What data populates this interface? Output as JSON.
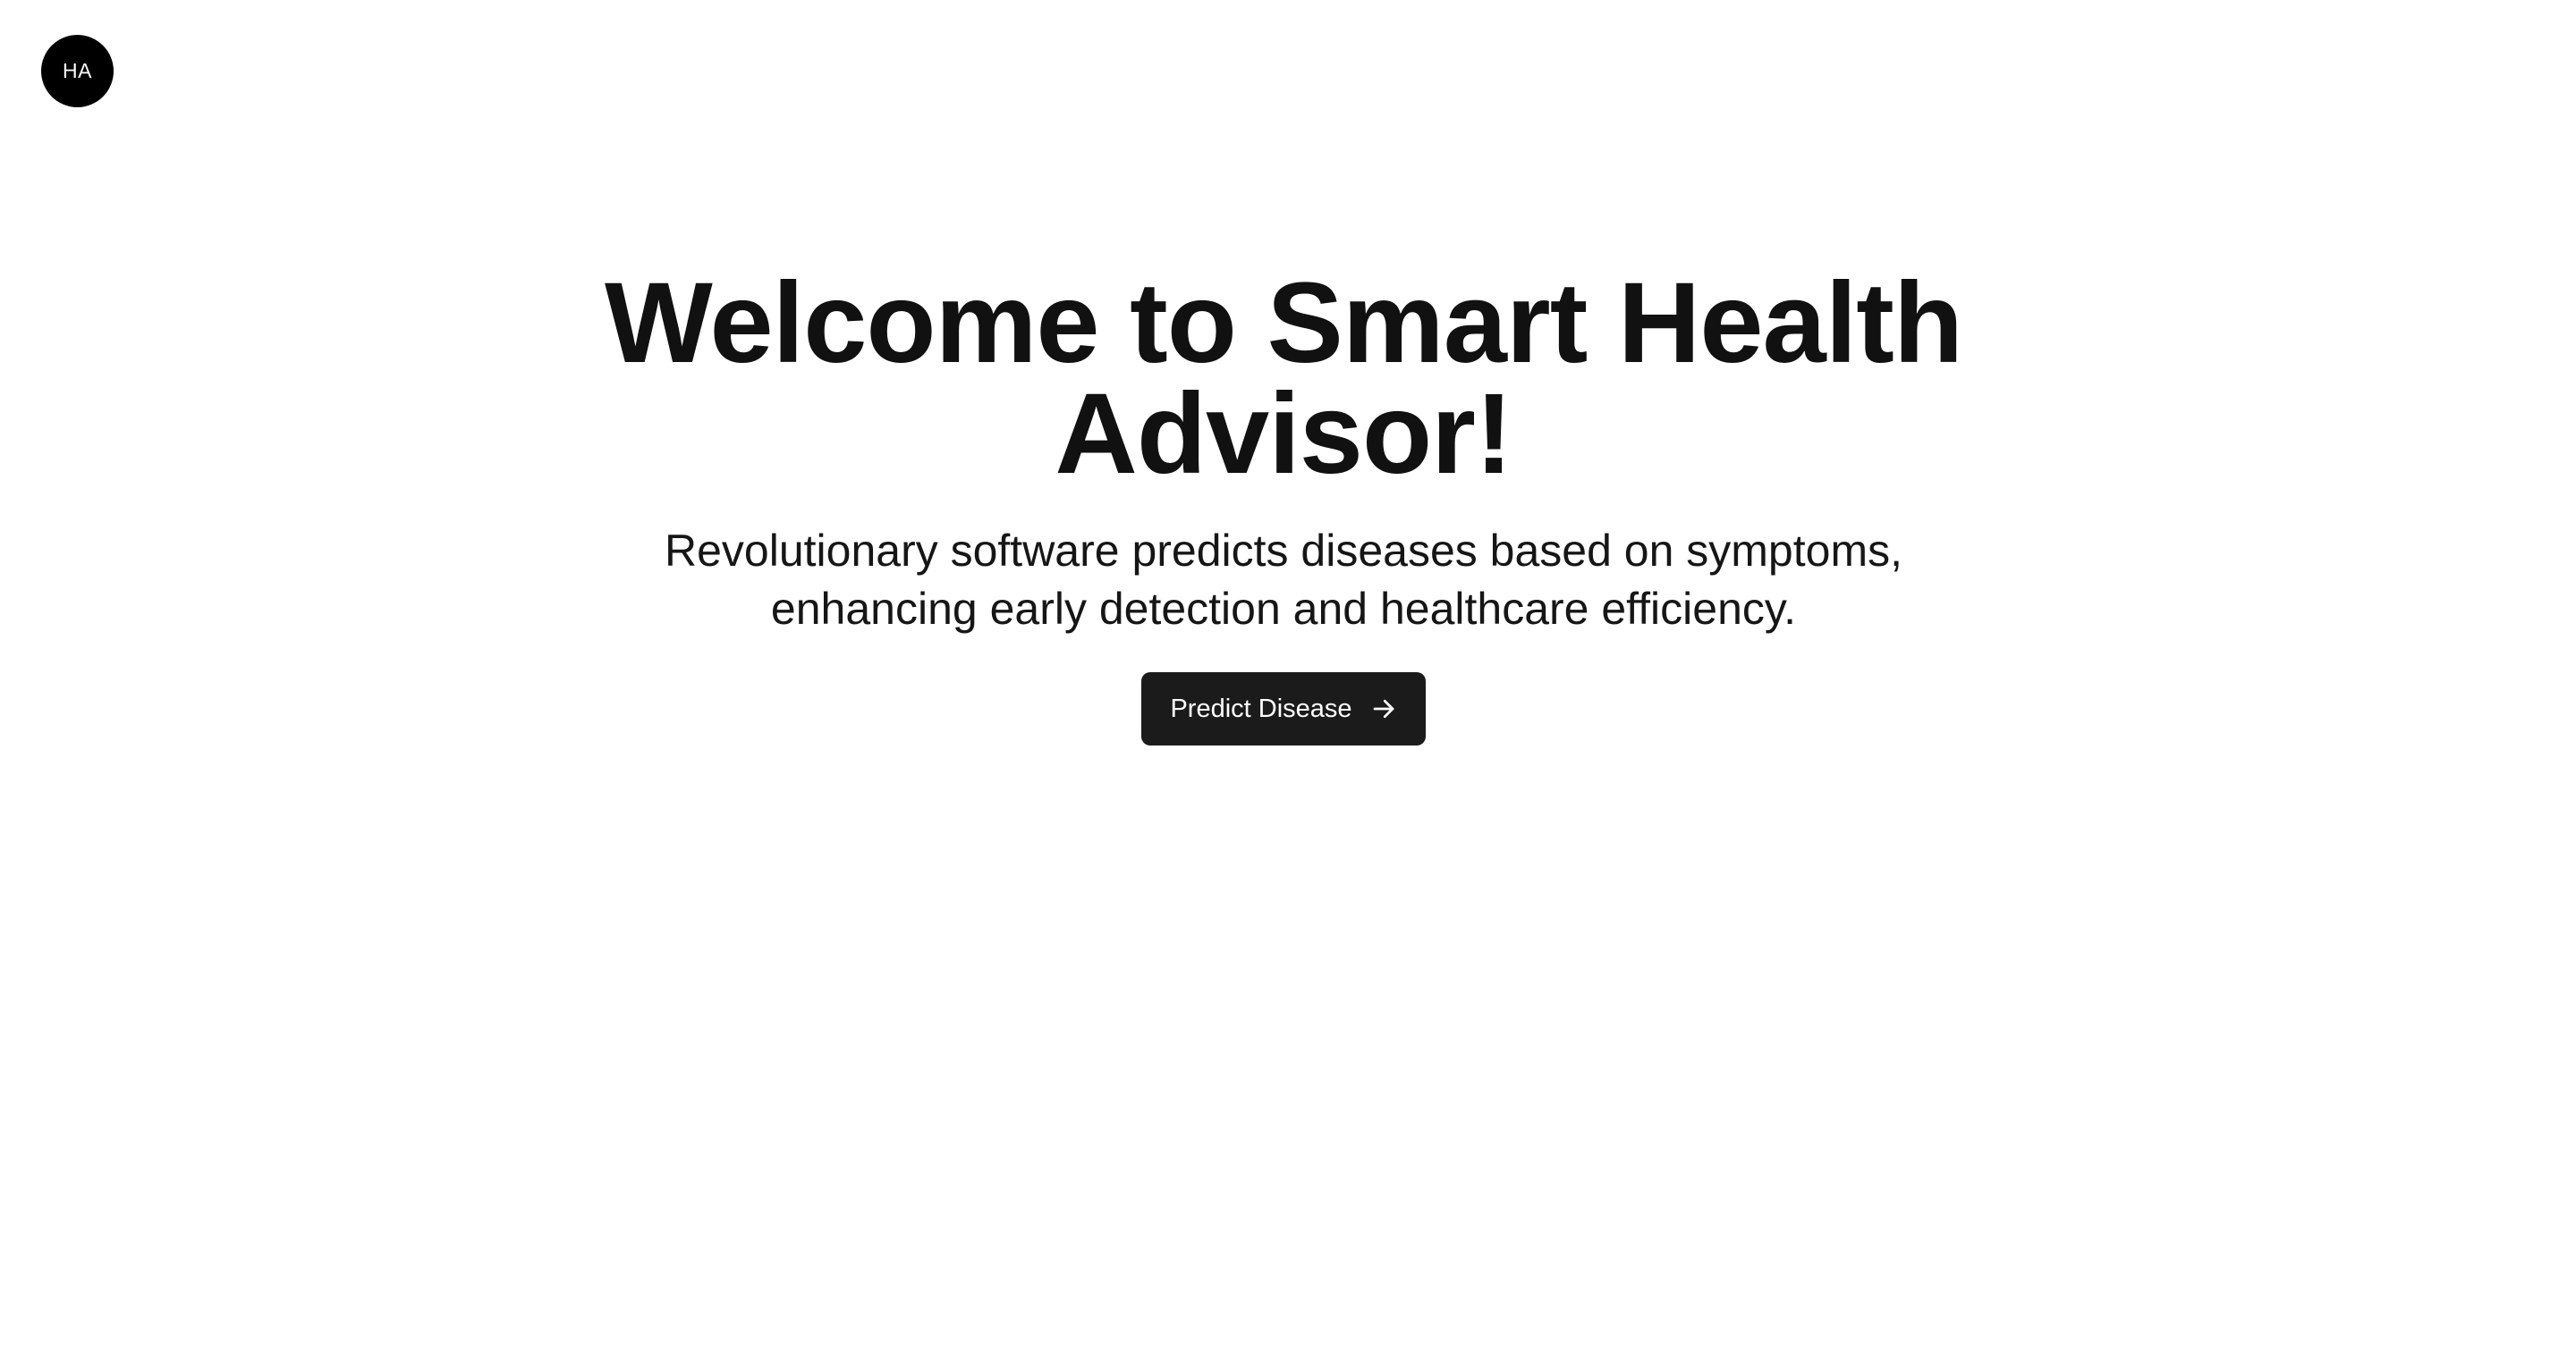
{
  "header": {
    "avatar_initials": "HA"
  },
  "hero": {
    "title": "Welcome to Smart Health Advisor!",
    "subtitle": "Revolutionary software predicts diseases based on symptoms, enhancing early detection and healthcare efficiency.",
    "cta_label": "Predict Disease",
    "cta_icon": "arrow-right-icon"
  },
  "colors": {
    "background": "#ffffff",
    "text": "#111111",
    "button_bg": "#1b1b1b",
    "button_text": "#ffffff",
    "avatar_bg": "#000000"
  }
}
